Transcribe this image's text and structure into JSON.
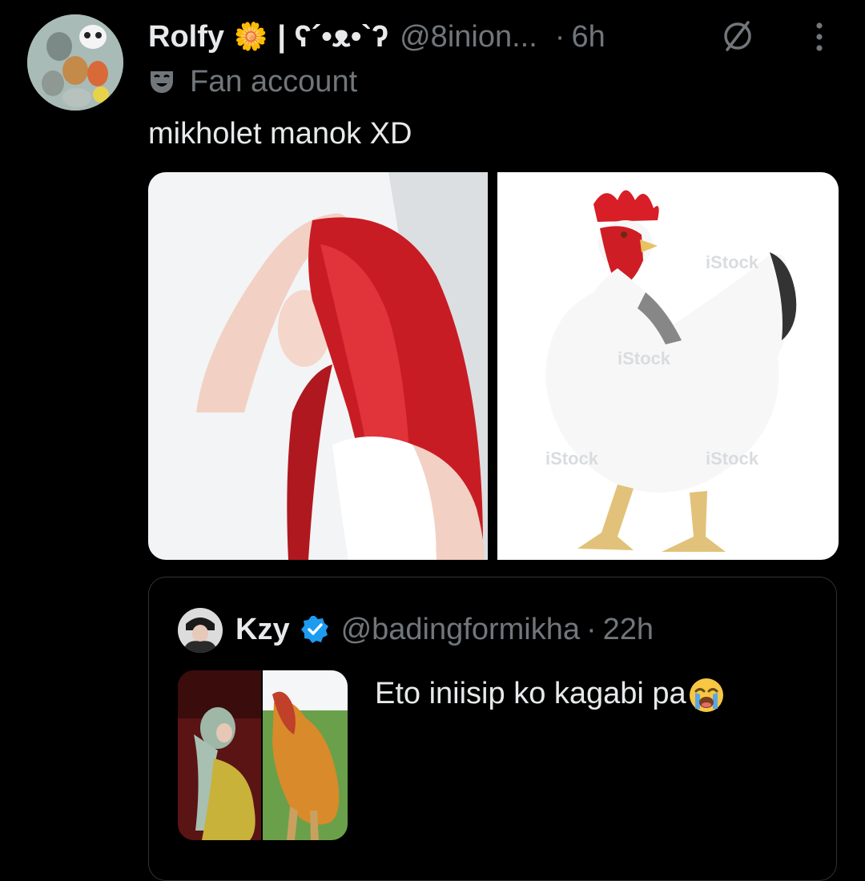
{
  "author": {
    "name": "Rolfy",
    "flower": "🌼",
    "kaomoji": "| ʕ´•ᴥ•`ʔ",
    "handle": "@8inion...",
    "separator": "·",
    "time": "6h",
    "label": "Fan account"
  },
  "tweet": {
    "text": "mikholet manok XD"
  },
  "quote": {
    "name": "Kzy",
    "handle": "@badingformikha",
    "separator": "·",
    "time": "22h",
    "text": "Eto iniisip ko kagabi pa"
  },
  "watermark": "iStock",
  "icons": {
    "label_icon": "mask-icon",
    "restrict_icon": "no-entry-icon",
    "menu_icon": "more-vertical-icon",
    "verified_icon": "verified-badge-icon",
    "emoji": "loudly-crying-face-emoji"
  },
  "colors": {
    "background": "#000000",
    "text": "#e7e9ea",
    "secondary": "#71767b",
    "border": "#2f3336",
    "verified": "#1d9bf0"
  }
}
